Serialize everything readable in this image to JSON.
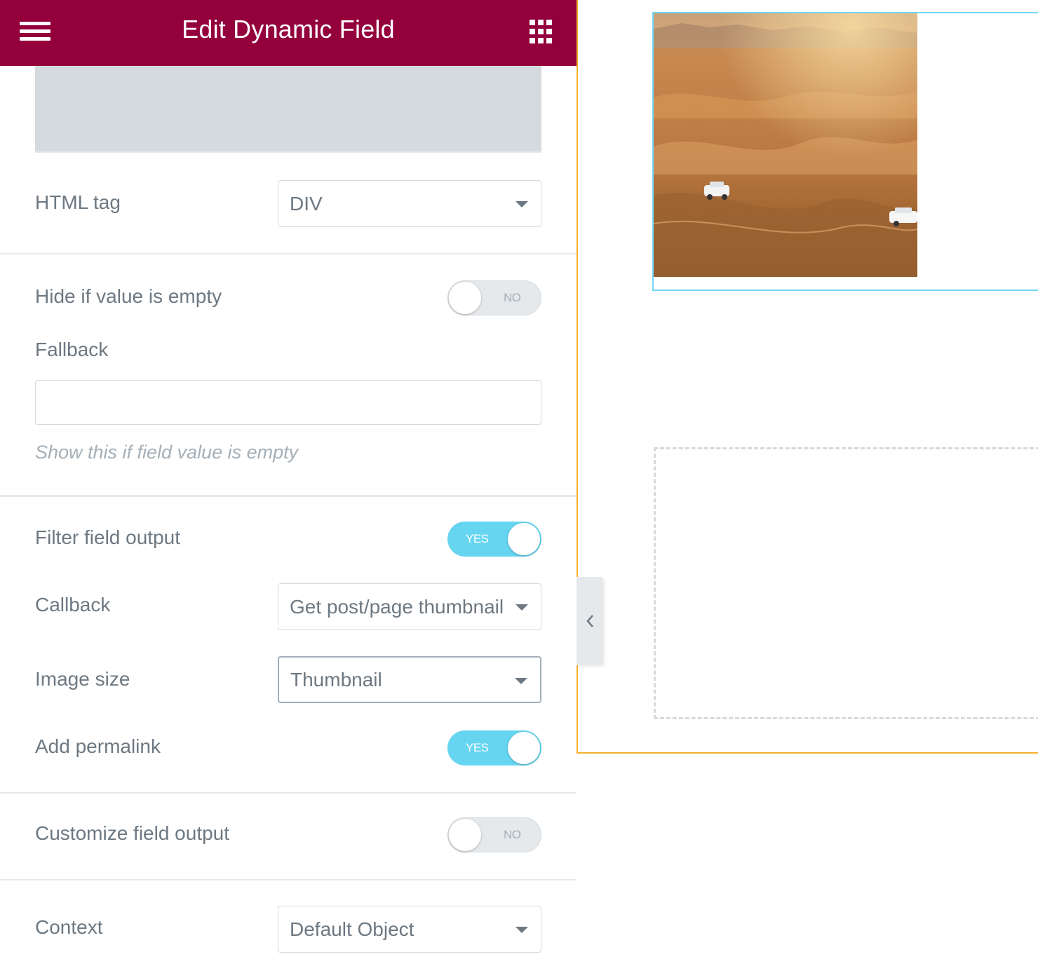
{
  "header": {
    "title": "Edit Dynamic Field",
    "menu_icon": "hamburger-menu-icon",
    "apps_icon": "apps-grid-icon",
    "bg_color": "#93003c"
  },
  "fields": {
    "html_tag": {
      "label": "HTML tag",
      "value": "DIV"
    },
    "hide_if_empty": {
      "label": "Hide if value is empty",
      "state": "NO"
    },
    "fallback": {
      "label": "Fallback",
      "value": "",
      "help": "Show this if field value is empty"
    },
    "filter_output": {
      "label": "Filter field output",
      "state": "YES"
    },
    "callback": {
      "label": "Callback",
      "value": "Get post/page thumbnail"
    },
    "image_size": {
      "label": "Image size",
      "value": "Thumbnail"
    },
    "add_permalink": {
      "label": "Add permalink",
      "state": "YES"
    },
    "customize_output": {
      "label": "Customize field output",
      "state": "NO"
    },
    "context": {
      "label": "Context",
      "value": "Default Object"
    }
  },
  "canvas": {
    "image_subject": "desert dunes with white SUVs",
    "collapse_icon": "chevron-left-icon"
  },
  "colors": {
    "accent": "#93003c",
    "toggle_on": "#66d5f0",
    "section_outline": "#f4b12c",
    "widget_outline": "#71d7f7",
    "text": "#6d7882"
  }
}
